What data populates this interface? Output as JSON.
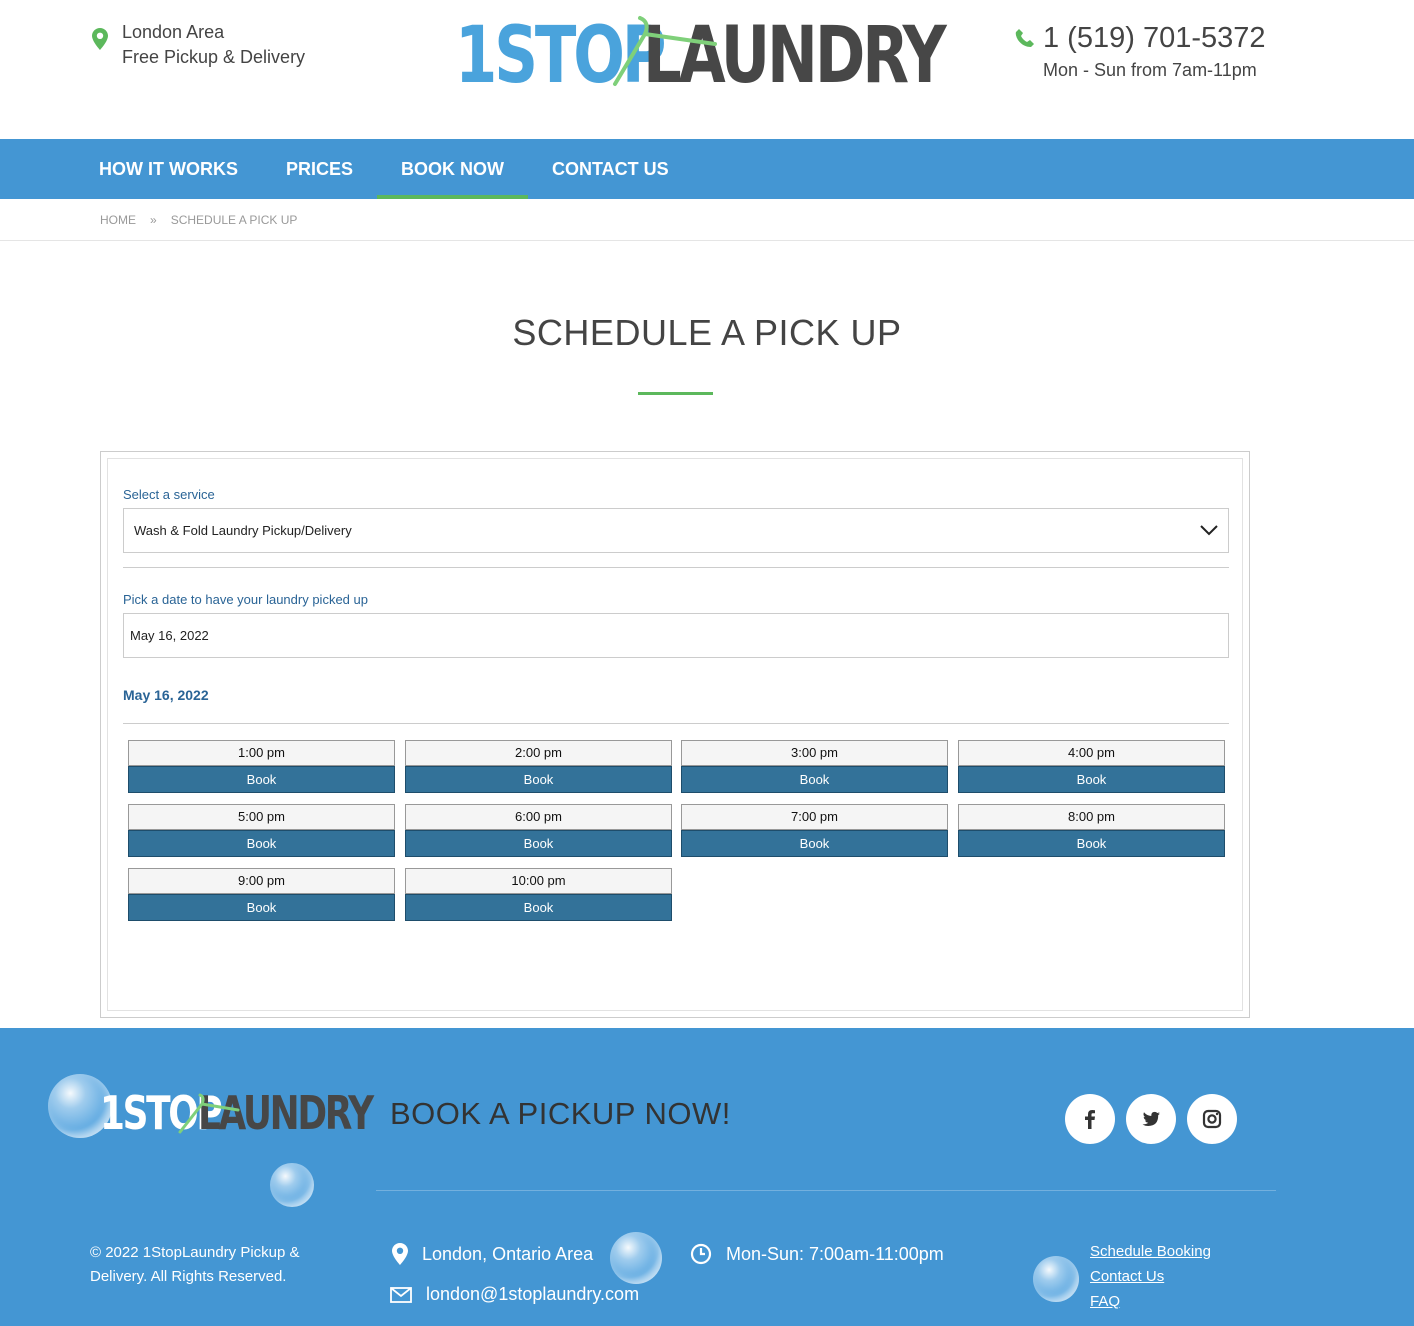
{
  "header": {
    "location_line1": "London Area",
    "location_line2": "Free Pickup & Delivery",
    "logo_part1": "1STOP",
    "logo_part2": "LAUNDRY",
    "phone": "1 (519) 701-5372",
    "hours": "Mon - Sun from 7am-11pm"
  },
  "nav": {
    "items": [
      {
        "label": "HOW IT WORKS"
      },
      {
        "label": "PRICES"
      },
      {
        "label": "BOOK NOW"
      },
      {
        "label": "CONTACT US"
      }
    ],
    "active_index": 2
  },
  "breadcrumb": {
    "home": "HOME",
    "separator": "»",
    "current": "SCHEDULE A PICK UP"
  },
  "page": {
    "title": "SCHEDULE A PICK UP"
  },
  "form": {
    "service_label": "Select a service",
    "service_value": "Wash & Fold Laundry Pickup/Delivery",
    "date_label": "Pick a date to have your laundry picked up",
    "date_value": "May 16, 2022",
    "date_heading": "May 16, 2022",
    "book_label": "Book",
    "slots": [
      "1:00 pm",
      "2:00 pm",
      "3:00 pm",
      "4:00 pm",
      "5:00 pm",
      "6:00 pm",
      "7:00 pm",
      "8:00 pm",
      "9:00 pm",
      "10:00 pm"
    ]
  },
  "footer": {
    "logo_part1": "1STOP",
    "logo_part2": "LAUNDRY",
    "cta": "BOOK A PICKUP NOW!",
    "social": [
      {
        "icon": "facebook-icon"
      },
      {
        "icon": "twitter-icon"
      },
      {
        "icon": "instagram-icon"
      }
    ],
    "copyright": "© 2022 1StopLaundry Pickup & Delivery. All Rights Reserved.",
    "location": "London, Ontario Area",
    "email": "london@1stoplaundry.com",
    "hours": "Mon-Sun: 7:00am-11:00pm",
    "links": [
      "Schedule Booking",
      "Contact Us",
      "FAQ"
    ]
  },
  "colors": {
    "brand_blue": "#4496d3",
    "logo_blue": "#4aa3dc",
    "accent_green": "#5cb85c",
    "button_blue": "#337299",
    "label_blue": "#2a6496"
  }
}
